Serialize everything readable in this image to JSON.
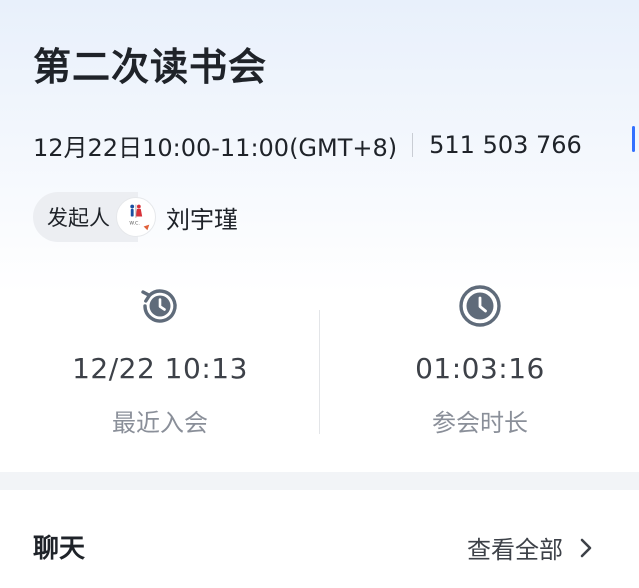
{
  "meeting": {
    "title": "第二次读书会",
    "time": "12月22日10:00-11:00(GMT+8)",
    "meeting_id": "511 503 766"
  },
  "host": {
    "label": "发起人",
    "name": "刘宇瑾",
    "avatar_icon": "wc-sign-avatar"
  },
  "stats": {
    "recent_join": {
      "value": "12/22 10:13",
      "label": "最近入会",
      "icon": "history-clock-icon"
    },
    "duration": {
      "value": "01:03:16",
      "label": "参会时长",
      "icon": "clock-icon"
    }
  },
  "chat": {
    "title": "聊天",
    "view_all": "查看全部"
  },
  "colors": {
    "accent": "#3370ff",
    "icon": "#5f6b7a",
    "muted_text": "#8a8f99"
  }
}
